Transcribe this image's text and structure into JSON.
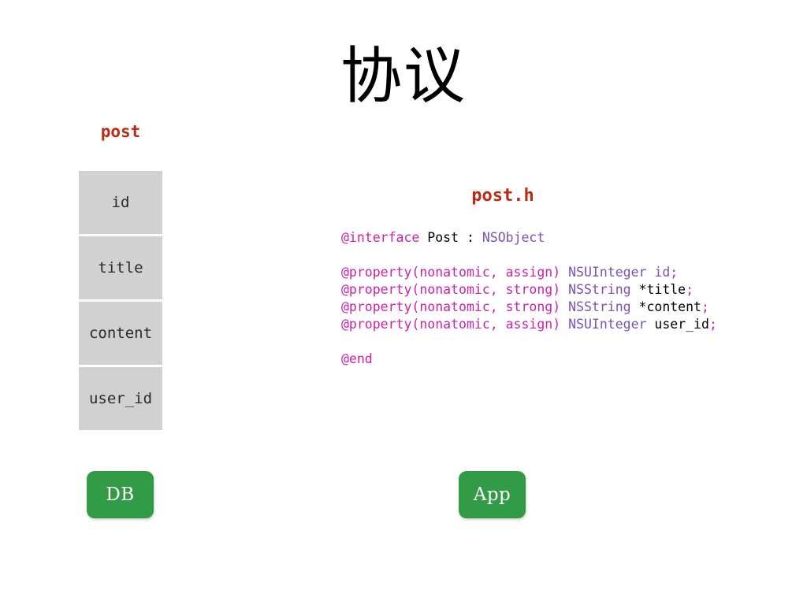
{
  "slide": {
    "title": "协议"
  },
  "db_table": {
    "name": "post",
    "columns": [
      {
        "label": "id"
      },
      {
        "label": "title"
      },
      {
        "label": "content"
      },
      {
        "label": "user_id"
      }
    ]
  },
  "boxes": {
    "db_label": "DB",
    "app_label": "App",
    "green": "#319b45"
  },
  "code": {
    "filename": "post.h",
    "filename_color": "#bb2b14",
    "lines": [
      {
        "id": "interface",
        "tokens": [
          {
            "text": "@interface",
            "kind": "kw"
          },
          {
            "text": " Post : ",
            "kind": "plain"
          },
          {
            "text": "NSObject",
            "kind": "type"
          }
        ]
      },
      {
        "id": "blank-1",
        "tokens": []
      },
      {
        "id": "property-id",
        "tokens": [
          {
            "text": "@property",
            "kind": "kw"
          },
          {
            "text": "(",
            "kind": "kw"
          },
          {
            "text": "nonatomic",
            "kind": "attr"
          },
          {
            "text": ", ",
            "kind": "kw"
          },
          {
            "text": "assign",
            "kind": "attr"
          },
          {
            "text": ") ",
            "kind": "kw"
          },
          {
            "text": "NSUInteger ",
            "kind": "type"
          },
          {
            "text": "id",
            "kind": "type"
          },
          {
            "text": ";",
            "kind": "kw"
          }
        ]
      },
      {
        "id": "property-title",
        "tokens": [
          {
            "text": "@property",
            "kind": "kw"
          },
          {
            "text": "(",
            "kind": "kw"
          },
          {
            "text": "nonatomic",
            "kind": "attr"
          },
          {
            "text": ", ",
            "kind": "kw"
          },
          {
            "text": "strong",
            "kind": "attr"
          },
          {
            "text": ") ",
            "kind": "kw"
          },
          {
            "text": "NSString ",
            "kind": "type"
          },
          {
            "text": "*title",
            "kind": "plain"
          },
          {
            "text": ";",
            "kind": "kw"
          }
        ]
      },
      {
        "id": "property-content",
        "tokens": [
          {
            "text": "@property",
            "kind": "kw"
          },
          {
            "text": "(",
            "kind": "kw"
          },
          {
            "text": "nonatomic",
            "kind": "attr"
          },
          {
            "text": ", ",
            "kind": "kw"
          },
          {
            "text": "strong",
            "kind": "attr"
          },
          {
            "text": ") ",
            "kind": "kw"
          },
          {
            "text": "NSString ",
            "kind": "type"
          },
          {
            "text": "*content",
            "kind": "plain"
          },
          {
            "text": ";",
            "kind": "kw"
          }
        ]
      },
      {
        "id": "property-user-id",
        "tokens": [
          {
            "text": "@property",
            "kind": "kw"
          },
          {
            "text": "(",
            "kind": "kw"
          },
          {
            "text": "nonatomic",
            "kind": "attr"
          },
          {
            "text": ", ",
            "kind": "kw"
          },
          {
            "text": "assign",
            "kind": "attr"
          },
          {
            "text": ") ",
            "kind": "kw"
          },
          {
            "text": "NSUInteger ",
            "kind": "type"
          },
          {
            "text": "user_id",
            "kind": "plain"
          },
          {
            "text": ";",
            "kind": "kw"
          }
        ]
      },
      {
        "id": "blank-2",
        "tokens": []
      },
      {
        "id": "end",
        "tokens": [
          {
            "text": "@end",
            "kind": "kw"
          }
        ]
      }
    ]
  }
}
